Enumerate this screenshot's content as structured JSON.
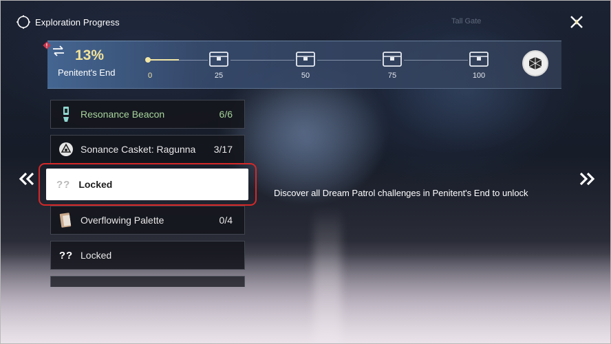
{
  "header": {
    "title": "Exploration Progress",
    "icon": "compass-icon"
  },
  "banner": {
    "percent": "13%",
    "region": "Penitent's End",
    "progress_fraction": 0.13,
    "milestones": [
      "0",
      "25",
      "50",
      "75",
      "100"
    ],
    "accent_color": "#f3e39a"
  },
  "list": {
    "items": [
      {
        "label": "Resonance Beacon",
        "count": "6/6",
        "icon": "beacon-icon",
        "color": "#a7d59b"
      },
      {
        "label": "Sonance Casket: Ragunna",
        "count": "3/17",
        "icon": "casket-icon"
      },
      {
        "label": "Locked",
        "count": "",
        "icon": "question-icon",
        "glyph": "??",
        "selected": true
      },
      {
        "label": "Overflowing Palette",
        "count": "0/4",
        "icon": "palette-icon"
      },
      {
        "label": "Locked",
        "count": "",
        "icon": "question-icon",
        "glyph": "??"
      }
    ]
  },
  "description": "Discover all Dream Patrol challenges in Penitent's End to unlock",
  "map_labels": [
    "Tall Gate"
  ],
  "highlight_color": "#d62828"
}
